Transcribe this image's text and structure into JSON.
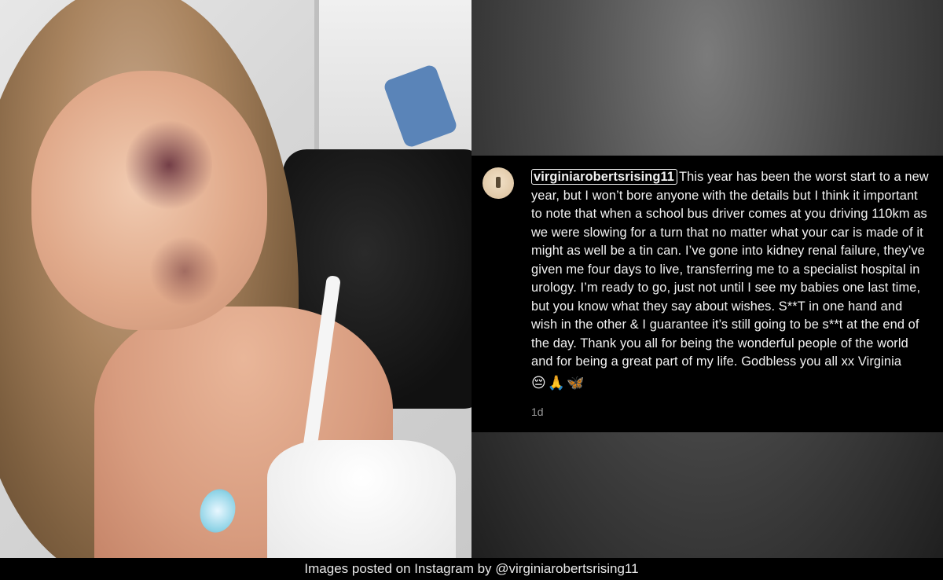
{
  "post": {
    "username": "virginiarobertsrising11",
    "text": "This year has been the worst start to a new year, but I won’t bore anyone with the details but I think it important to note that when a school bus driver comes at you driving 110km as we were slowing for a turn that no matter what your car is made of it might as well be a tin can. I’ve gone into kidney renal failure, they’ve given me four days to live, transferring me to a specialist hospital in urology. I’m ready to go, just not until I see my babies one last time, but you know what they say about wishes. S**T in one hand and wish in the other & I guarantee it’s still going to be s**t at the end of the day. Thank you all for being the wonderful people of the world and for being a great part of my life. Godbless you all xx Virginia",
    "emojis": "😔🙏🦋",
    "timestamp": "1d"
  },
  "caption": "Images posted on Instagram by @virginiarobertsrising11",
  "icons": {
    "avatar": "user-avatar"
  },
  "colors": {
    "card_bg": "#000000",
    "text": "#f2f2f2",
    "muted": "#9a9a9a"
  }
}
